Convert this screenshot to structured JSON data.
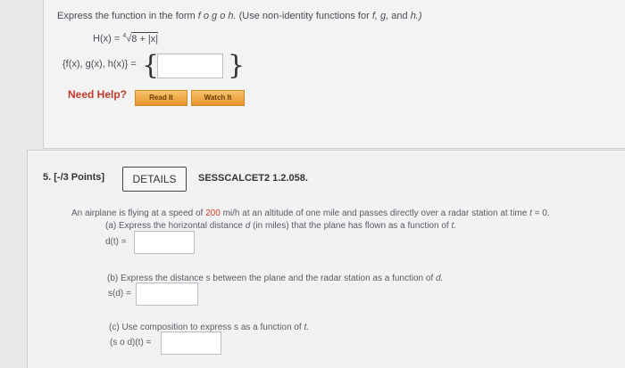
{
  "q_prev": {
    "instruction_prefix": "Express the function in the form",
    "instruction_form": "f o g o h.",
    "instruction_suffix": "(Use non-identity functions for",
    "v_f": "f,",
    "v_g": "g,",
    "instruction_and": "and",
    "v_h": "h.)",
    "func_lhs": "H(x) =",
    "root_index": "4",
    "radicand": "8 + |x|",
    "tuple_label": "{f(x), g(x), h(x)} =",
    "brace_open": "{",
    "brace_close": "}",
    "answer_value": "",
    "need_help": "Need Help?",
    "read_it": "Read It",
    "watch_it": "Watch It"
  },
  "q5": {
    "number": "5.",
    "points": "[-/3 Points]",
    "details_button": "DETAILS",
    "code": "SESSCALCET2 1.2.058.",
    "intro_pre": "An airplane is flying at a speed of",
    "speed": "200",
    "speed_unit": "mi/h",
    "intro_mid": "at an altitude of one mile and passes directly over a radar station at time",
    "t_var": "t",
    "intro_end": "= 0.",
    "part_a_pre": "(a) Express the horizontal distance",
    "part_a_d": "d",
    "part_a_mid": "(in miles) that the plane has flown as a function of",
    "part_a_t": "t.",
    "part_a_label": "d(t) =",
    "part_a_value": "",
    "part_b_text": "(b) Express the distance s between the plane and the radar station as a function of",
    "part_b_d": "d.",
    "part_b_label": "s(d) =",
    "part_b_value": "",
    "part_c_text": "(c) Use composition to express s as a function of",
    "part_c_t": "t.",
    "part_c_label": "(s o d)(t) =",
    "part_c_value": ""
  }
}
